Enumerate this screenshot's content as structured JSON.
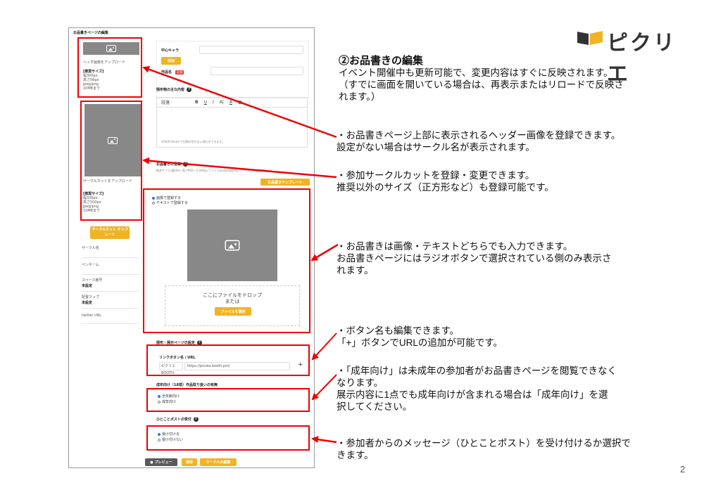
{
  "logo": {
    "text": "ピクリエ",
    "colors": {
      "dark": "#333333",
      "accent": "#f0b323"
    }
  },
  "page_number": "2",
  "screenshot": {
    "page_title": "お品書きページの編集",
    "sidebar": {
      "header_upload": "ヘッダ画像をアップロード",
      "header_spec": [
        "[推奨サイズ]",
        "幅300px",
        "高さ56px",
        "jpeg/png",
        "10MBまで"
      ],
      "cut_upload": "サークルカットをアップロード",
      "cut_spec": [
        "[推奨サイズ]",
        "幅336px",
        "高さ500px",
        "jpeg/png",
        "10MBまで"
      ],
      "cut_template_btn": "サークルカット テンプレート",
      "circle_name": "サークル名",
      "pen_name": "ペンネーム",
      "space_label": "スペース番号",
      "space_value": "未設定",
      "map_label": "配置マップ",
      "map_value": "未設定",
      "twitter": "twitter URL"
    },
    "form": {
      "main_chara_label": "中心キャラ",
      "add_btn": "追加",
      "work_label": "作品名",
      "required": "必須",
      "content_label": "頒布物の主な内容",
      "toolbar": [
        "段落",
        "B",
        "U",
        "I",
        "A|",
        "A",
        "▦",
        "⋮"
      ],
      "editor_hint": "※Shift+Enterで行間の空かない改行ができます。",
      "oshina_label": "お品書きの登録",
      "oshina_hint": "推奨サイズ:幅600〜高さ900〜2,400px ファイル形式jpeg/png ファイルサイズ10MBまで",
      "oshina_template_btn": "お品書きテンプレート",
      "radio_image": "画像で登録する",
      "radio_text": "テキストで登録する",
      "drop_line1": "ここにファイルをドロップ",
      "drop_line2": "または",
      "file_btn": "ファイルを選択",
      "link_section": "頒布・展示ページの設定",
      "link_label": "リンクボタン名 / URL",
      "link_name_ph": "ピクリエBOOTH",
      "link_url_ph": "https://picrea.booth.pm/",
      "plus": "+",
      "adult_label": "成年向け（18禁）作品取り扱いの有無",
      "adult_opt1": "全年齢向け",
      "adult_opt2": "成年向け",
      "post_label": "ひとことポストの受付",
      "post_opt1": "受け付ける",
      "post_opt2": "受け付けない",
      "preview_btn": "プレビュー",
      "save_btn": "保存",
      "circle_edit_btn": "サークルの編集"
    }
  },
  "annotations": {
    "title": "②お品書きの編集",
    "intro": [
      "イベント開催中も更新可能で、変更内容はすぐに反映されます。",
      "（すでに画面を開いている場合は、再表示またはリロードで反映さ",
      "れます。）"
    ],
    "header": [
      "・お品書きページ上部に表示されるヘッダー画像を登録できます。",
      "設定がない場合はサークル名が表示されます。"
    ],
    "cut": [
      "・参加サークルカットを登録・変更できます。",
      "推奨以外のサイズ（正方形など）も登録可能です。"
    ],
    "oshina": [
      "・お品書きは画像・テキストどちらでも入力できます。",
      "お品書きページにはラジオボタンで選択されている側のみ表示さ",
      "れます。"
    ],
    "button": [
      "・ボタン名も編集できます。",
      "「+」ボタンでURLの追加が可能です。"
    ],
    "adult": [
      "・「成年向け」は未成年の参加者がお品書きページを閲覧できなく",
      "なります。",
      "展示内容に1点でも成年向けが含まれる場合は「成年向け」を選",
      "択してください。"
    ],
    "post": [
      "・参加者からのメッセージ（ひとことポスト）を受け付けるか選択で",
      "きます。"
    ]
  }
}
